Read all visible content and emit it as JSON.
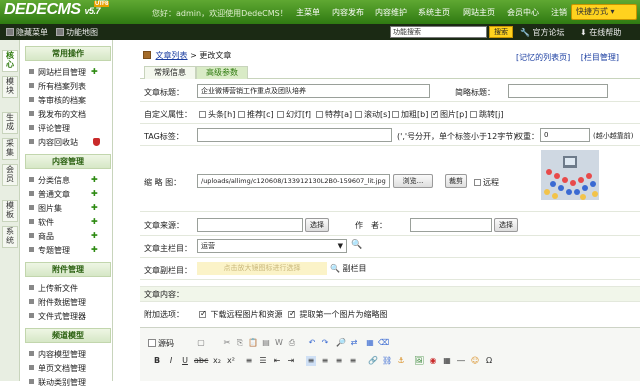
{
  "brand": {
    "logo": "DEDECMS",
    "version": "v5.7",
    "tag": "UTF8"
  },
  "header": {
    "welcome": "您好：admin，欢迎使用DedeCMS！",
    "nav": [
      "主菜单",
      "内容发布",
      "内容维护",
      "系统主页",
      "网站主页",
      "会员中心",
      "注销"
    ],
    "shortcut": "快捷方式"
  },
  "subbar": {
    "hide_menu": "隐藏菜单",
    "func_map": "功能地图",
    "search_value": "功能搜索",
    "search_button": "搜索",
    "forum": "官方论坛",
    "help": "在线帮助"
  },
  "side_tabs": [
    "核心",
    "模块",
    "生成",
    "采集",
    "会员",
    "模板",
    "系统"
  ],
  "menu": {
    "groups": [
      {
        "title": "常用操作",
        "items": [
          "网站栏目管理",
          "所有档案列表",
          "等审核的档案",
          "我发布的文档",
          "评论管理",
          "内容回收站"
        ]
      },
      {
        "title": "内容管理",
        "items": [
          "分类信息",
          "普通文章",
          "图片集",
          "软件",
          "商品",
          "专题管理"
        ]
      },
      {
        "title": "附件管理",
        "items": [
          "上传新文件",
          "附件数据管理",
          "文件式管理器"
        ]
      },
      {
        "title": "频道模型",
        "items": [
          "内容模型管理",
          "单页文档管理",
          "联动类别管理"
        ]
      }
    ]
  },
  "breadcrumb": {
    "list": "文章列表",
    "sep": ">",
    "current": "更改文章"
  },
  "right_links": {
    "recent": "[记忆的列表页]",
    "column": "[栏目管理]"
  },
  "tabs": [
    "常规信息",
    "高级参数"
  ],
  "form": {
    "title_label": "文章标题：",
    "title_value": "企业微博营销工作重点及团队培养",
    "short_title_label": "简略标题：",
    "attr_label": "自定义属性：",
    "attrs": [
      {
        "label": "头条[h]",
        "checked": false
      },
      {
        "label": "推荐[c]",
        "checked": false
      },
      {
        "label": "幻灯[f]",
        "checked": false
      },
      {
        "label": "特荐[a]",
        "checked": false
      },
      {
        "label": "滚动[s]",
        "checked": false
      },
      {
        "label": "加粗[b]",
        "checked": false
      },
      {
        "label": "图片[p]",
        "checked": true
      },
      {
        "label": "跳转[j]",
        "checked": false
      }
    ],
    "tag_label": "TAG标签：",
    "tag_hint": "(','号分开，单个标签小于12字节)",
    "weight_label": "权重：",
    "weight_value": "0",
    "weight_hint": "(越小越靠前)",
    "thumb_label": "缩 略 图：",
    "thumb_path": "/uploads/allimg/c120608/133912130L2B0-159607_lit.jpg",
    "browse_button": "浏览...",
    "crop_button": "裁剪",
    "remote_label": "远程",
    "source_label": "文章来源：",
    "source_select": "选择",
    "author_label": "作　者：",
    "author_select": "选择",
    "column_label": "文章主栏目：",
    "column_value": "运营",
    "sub_column_label": "文章副栏目：",
    "sub_column_hint": "点击放大镜图标进行选择",
    "sub_column_link": "副栏目",
    "content_label": "文章内容：",
    "extra_label": "附加选项：",
    "download_remote": "下载远程图片和资源",
    "first_pic": "提取第一个图片为缩略图"
  },
  "editor": {
    "source_label": "源码"
  },
  "colors": {
    "brand_green": "#2f7a12",
    "accent_yellow": "#ffd21e",
    "link_blue": "#1a3da0"
  }
}
